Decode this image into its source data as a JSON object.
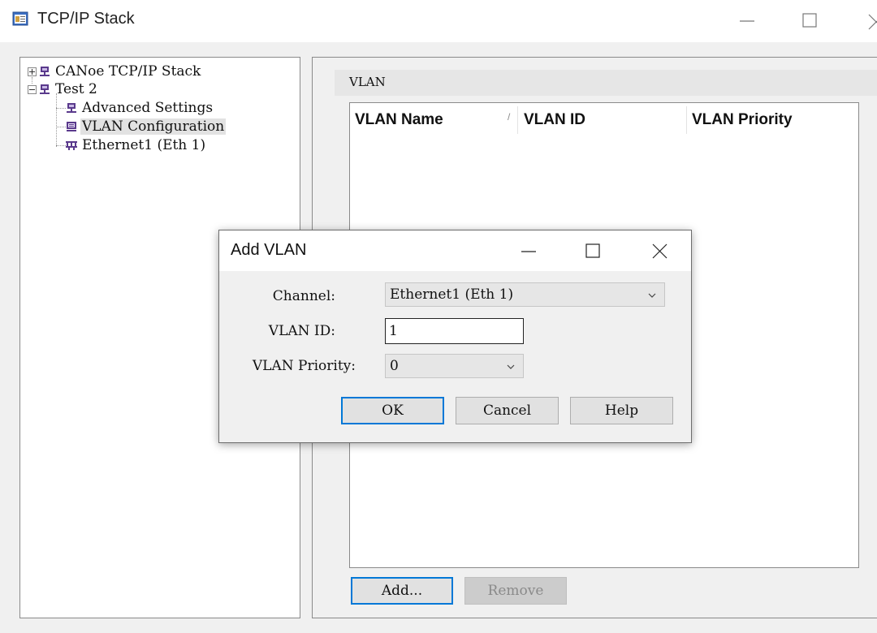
{
  "window": {
    "title": "TCP/IP Stack",
    "minimize_icon": "minimize-icon",
    "maximize_icon": "maximize-icon",
    "close_icon": "close-icon"
  },
  "tree": {
    "items": [
      {
        "label": "CANoe TCP/IP Stack",
        "expander": "plus",
        "icon": "network-node-icon"
      },
      {
        "label": "Test 2",
        "expander": "minus",
        "icon": "network-node-icon"
      },
      {
        "label": "Advanced Settings",
        "icon": "network-node-icon"
      },
      {
        "label": "VLAN Configuration",
        "icon": "vlan-config-icon",
        "selected": true
      },
      {
        "label": "Ethernet1 (Eth 1)",
        "icon": "ethernet-icon"
      }
    ]
  },
  "vlan_panel": {
    "section_title": "VLAN",
    "columns": [
      "VLAN Name",
      "VLAN ID",
      "VLAN Priority"
    ],
    "rows": [],
    "add_label": "Add...",
    "remove_label": "Remove"
  },
  "dialog": {
    "title": "Add VLAN",
    "channel_label": "Channel:",
    "channel_value": "Ethernet1 (Eth 1)",
    "vlan_id_label": "VLAN ID:",
    "vlan_id_value": "1",
    "vlan_priority_label": "VLAN Priority:",
    "vlan_priority_value": "0",
    "ok_label": "OK",
    "cancel_label": "Cancel",
    "help_label": "Help"
  },
  "colors": {
    "accent": "#0078d7",
    "tree_icon": "#5a3a8c",
    "selection": "#e2e2e2"
  }
}
